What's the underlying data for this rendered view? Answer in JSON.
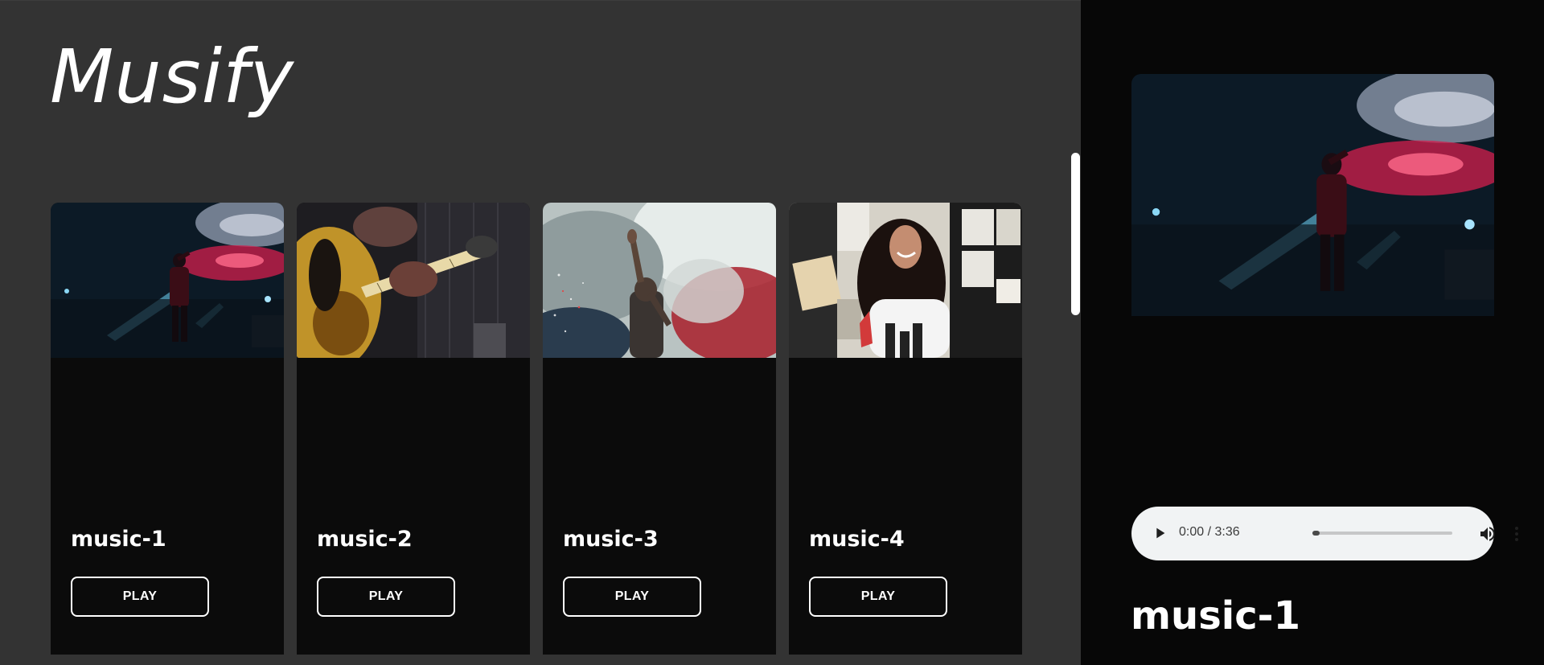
{
  "app": {
    "brand": "Musify"
  },
  "library": {
    "tracks": [
      {
        "title": "music-1",
        "play_label": "PLAY",
        "image": "concert-stage-red-lights"
      },
      {
        "title": "music-2",
        "play_label": "PLAY",
        "image": "bass-guitar-closeup"
      },
      {
        "title": "music-3",
        "play_label": "PLAY",
        "image": "festival-smoke-crowd"
      },
      {
        "title": "music-4",
        "play_label": "PLAY",
        "image": "woman-headphones-smiling"
      }
    ]
  },
  "player": {
    "cover_image": "concert-stage-red-lights",
    "time": "0:00 / 3:36",
    "progress": 0.0,
    "now_playing": "music-1",
    "icons": {
      "play": "play-icon",
      "volume": "volume-icon",
      "more": "more-vert-icon"
    }
  },
  "colors": {
    "library_bg": "#333333",
    "card_bg": "#0b0b0b",
    "player_bg": "#070707",
    "audio_bg": "#f1f3f4",
    "text": "#ffffff"
  }
}
